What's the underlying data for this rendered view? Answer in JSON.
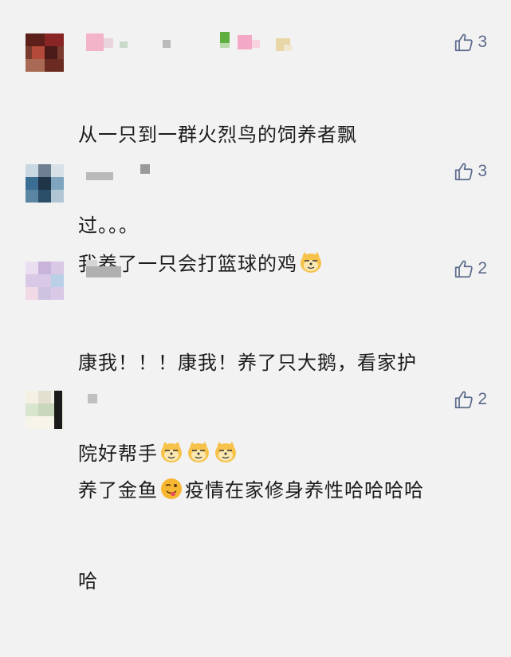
{
  "comments": [
    {
      "likes": "3",
      "text_line1": "从一只到一群火烈鸟的饲养者飘",
      "text_line2": "过。。。",
      "emoji": []
    },
    {
      "likes": "3",
      "text_line1": "我养了一只会打篮球的鸡",
      "emoji": [
        "doge"
      ]
    },
    {
      "likes": "2",
      "text_line1": "康我！！！康我！养了只大鹅，看家护",
      "text_line2": "院好帮手",
      "emoji": [
        "doge",
        "doge",
        "doge"
      ]
    },
    {
      "likes": "2",
      "text_line1a": "养了金鱼",
      "text_line1b": "疫情在家修身养性哈哈哈哈",
      "text_line2": "哈",
      "emoji": [
        "wink-tongue"
      ]
    }
  ],
  "icons": {
    "like": "thumbs-up-icon",
    "doge": "doge-emoji-icon",
    "wink": "wink-tongue-emoji-icon"
  },
  "colors": {
    "background": "#f2f2f2",
    "like_accent": "#5b6b8c",
    "text": "#1c1c1c"
  }
}
